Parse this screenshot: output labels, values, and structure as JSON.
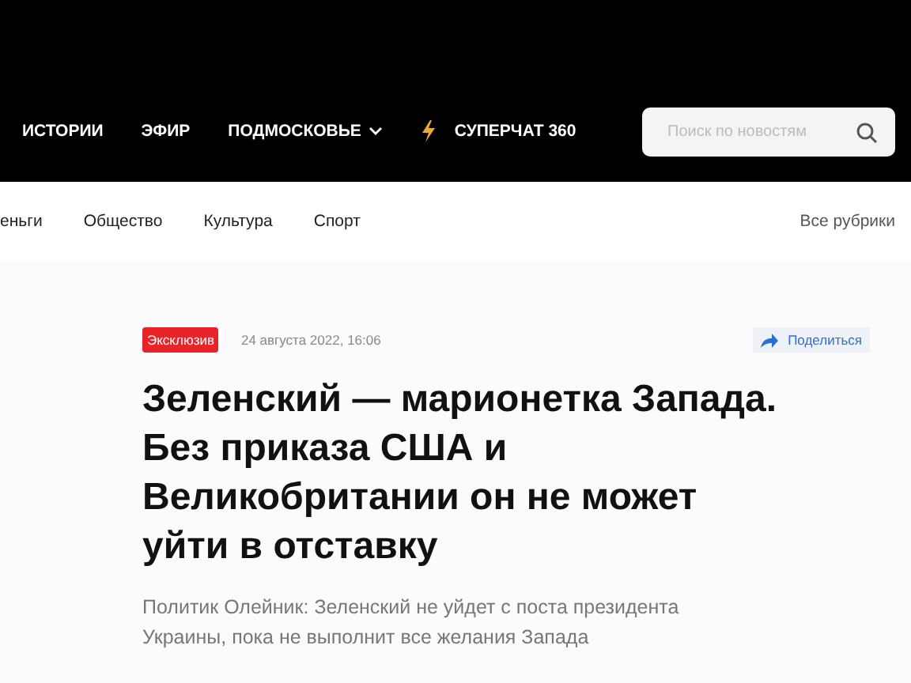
{
  "nav": {
    "items": [
      {
        "label": "ИСТОРИИ",
        "kind": "link"
      },
      {
        "label": "ЭФИР",
        "kind": "link"
      },
      {
        "label": "ПОДМОСКОВЬЕ",
        "kind": "dropdown"
      },
      {
        "label": "СУПЕРЧАТ 360",
        "kind": "bolt"
      }
    ],
    "search": {
      "placeholder": "Поиск по новостям"
    }
  },
  "rubrics": {
    "items": [
      "еньги",
      "Общество",
      "Культура",
      "Спорт"
    ],
    "all": "Все рубрики"
  },
  "article": {
    "badge": "Эксклюзив",
    "date": "24 августа 2022, 16:06",
    "share": "Поделиться",
    "title": "Зеленский — марионетка Запада. Без приказа США и Великобритании он не может уйти в отставку",
    "lead": "Политик Олейник: Зеленский не уйдет с поста президента Украины, пока не выполнит все желания Запада"
  }
}
